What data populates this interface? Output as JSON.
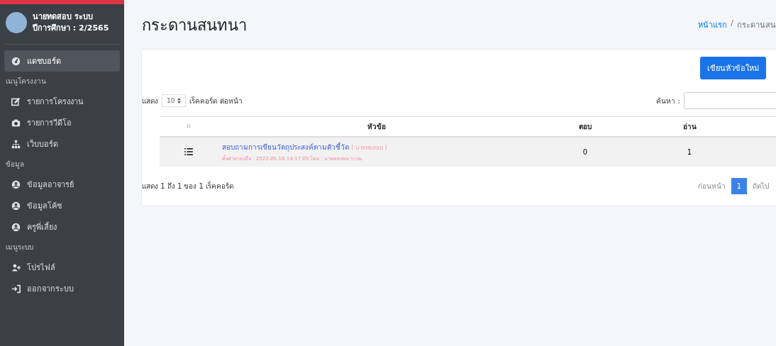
{
  "user": {
    "name": "นายทดสอบ ระบบ",
    "subtitle": "ปีการศึกษา : 2/2565"
  },
  "sidebar": {
    "items": [
      {
        "kind": "item",
        "label": "แดชบอร์ด",
        "selected": true
      },
      {
        "kind": "header",
        "label": "เมนูโครงงาน"
      },
      {
        "kind": "item",
        "label": "รายการโครงงาน",
        "selected": false
      },
      {
        "kind": "item",
        "label": "รายการวีดีโอ",
        "selected": false
      },
      {
        "kind": "item",
        "label": "เว็บบอร์ด",
        "selected": false
      },
      {
        "kind": "header",
        "label": "ข้อมูล"
      },
      {
        "kind": "item",
        "label": "ข้อมูลอาจารย์",
        "selected": false
      },
      {
        "kind": "item",
        "label": "ข้อมูลโค้ช",
        "selected": false
      },
      {
        "kind": "item",
        "label": "ครูพี่เลี้ยง",
        "selected": false
      },
      {
        "kind": "header",
        "label": "เมนูระบบ"
      },
      {
        "kind": "item",
        "label": "โปรไฟล์",
        "selected": false
      },
      {
        "kind": "item",
        "label": "ออกจากระบบ",
        "selected": false
      }
    ]
  },
  "page": {
    "title": "กระดานสนทนา",
    "breadcrumb": [
      "หน้าแรก",
      "กระดานสน"
    ],
    "breadcrumb_separator": "/"
  },
  "new_topic_button": "เขียนหัวข้อใหม่",
  "length": {
    "prefix": "แสดง",
    "value": "10",
    "suffix": "เร็คคอร์ด ต่อหน้า"
  },
  "search": {
    "label": "ค้นหา :"
  },
  "table": {
    "columns": [
      "หัวข้อ",
      "ตอบ",
      "อ่าน"
    ],
    "rows": [
      {
        "title": "สอบถามการเขียนวัตถุประสงค์ตามตัวชี้วัด",
        "author": "( นายทดสอบ )",
        "meta": "ตั้งคำถามเมื่อ : 2022-05-18 14:17:09 โดย : นายทดสอบ ระบบ",
        "replies": "0",
        "reads": "1"
      }
    ]
  },
  "info": "แสดง 1 ถึง 1 ของ 1 เร็คคอร์ด",
  "pagination": {
    "previous": "ก่อนหน้า",
    "pages": [
      {
        "label": "1",
        "selected": true
      }
    ],
    "next": "ถัดไป"
  }
}
